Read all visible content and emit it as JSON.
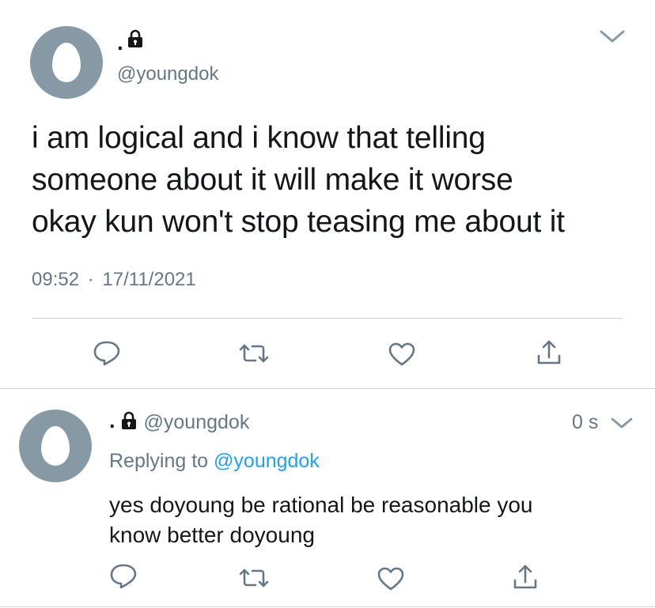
{
  "main_tweet": {
    "display_name": ".",
    "handle": "@youngdok",
    "text_lines": [
      "i am logical and i know that telling",
      "someone about it will make it worse",
      "okay kun won't stop teasing me about it"
    ],
    "time": "09:52",
    "separator": "·",
    "date": "17/11/2021",
    "icons": [
      "lock-icon",
      "chevron-down-icon",
      "reply-icon",
      "retweet-icon",
      "like-icon",
      "share-icon"
    ]
  },
  "reply_tweet": {
    "display_name": ".",
    "handle": "@youngdok",
    "timestamp": "0 s",
    "replying_prefix": "Replying to",
    "replying_handle": "@youngdok",
    "text_lines": [
      "yes doyoung be rational be reasonable you",
      "know better doyoung"
    ]
  },
  "colors": {
    "icon_gray": "#657786",
    "link_blue": "#1da1f2",
    "avatar_bg": "#8899a6",
    "divider": "#ccd6dd"
  }
}
